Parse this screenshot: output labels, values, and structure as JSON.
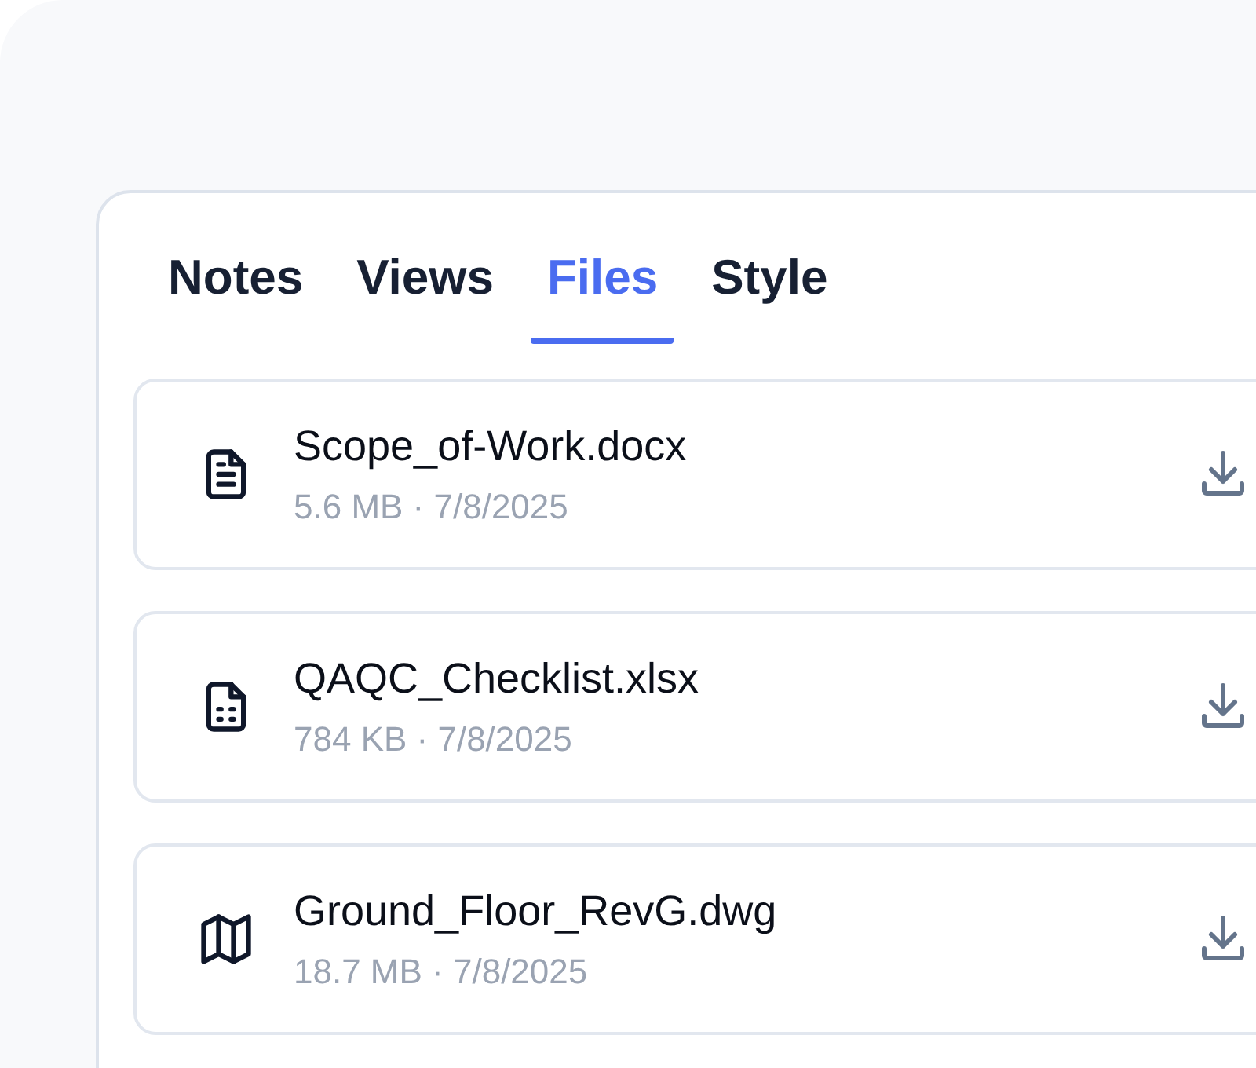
{
  "tabs": [
    {
      "label": "Notes",
      "selected": false
    },
    {
      "label": "Views",
      "selected": false
    },
    {
      "label": "Files",
      "selected": true
    },
    {
      "label": "Style",
      "selected": false
    }
  ],
  "files": [
    {
      "kind": "document",
      "name": "Scope_of-Work.docx",
      "meta": "5.6 MB · 7/8/2025"
    },
    {
      "kind": "spreadsheet",
      "name": "QAQC_Checklist.xlsx",
      "meta": "784 KB · 7/8/2025"
    },
    {
      "kind": "map",
      "name": "Ground_Floor_RevG.dwg",
      "meta": "18.7 MB · 7/8/2025"
    }
  ]
}
